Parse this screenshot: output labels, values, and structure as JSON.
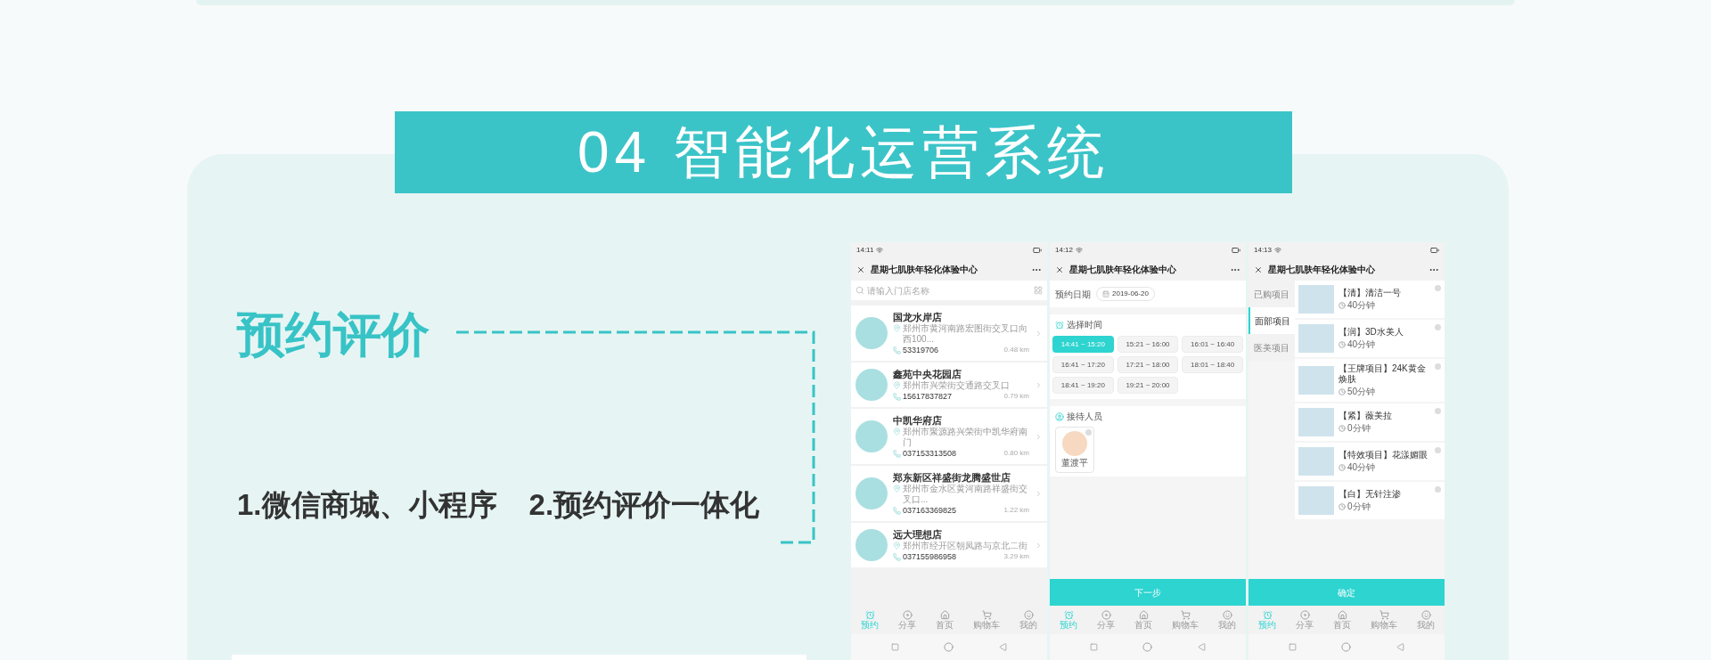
{
  "banner": {
    "title": "04 智能化运营系统"
  },
  "feature": {
    "title": "预约评价",
    "points": [
      "1.微信商城、小程序",
      "2.预约评价一体化"
    ]
  },
  "phones": [
    {
      "kind": "store_list",
      "time": "14:11",
      "app_title": "星期七肌肤年轻化体验中心",
      "search": {
        "placeholder": "请输入门店名称"
      },
      "stores": [
        {
          "name": "国龙水岸店",
          "address": "郑州市黄河南路宏图街交叉口向西100...",
          "phone": "53319706",
          "distance": "0.48 km"
        },
        {
          "name": "鑫苑中央花园店",
          "address": "郑州市兴荣街交通路交叉口",
          "phone": "15617837827",
          "distance": "0.79 km"
        },
        {
          "name": "中凯华府店",
          "address": "郑州市聚源路兴荣街中凯华府南门",
          "phone": "037153313508",
          "distance": "0.80 km"
        },
        {
          "name": "郑东新区祥盛街龙腾盛世店",
          "address": "郑州市金水区黄河南路祥盛街交叉口...",
          "phone": "037163369825",
          "distance": "1.22 km"
        },
        {
          "name": "远大理想店",
          "address": "郑州市经开区朝凤路与京北二街",
          "phone": "037155986958",
          "distance": "3.29 km"
        }
      ],
      "tabs": [
        {
          "label": "预约",
          "selected": true
        },
        {
          "label": "分享",
          "selected": false
        },
        {
          "label": "首页",
          "selected": false
        },
        {
          "label": "购物车",
          "selected": false
        },
        {
          "label": "我的",
          "selected": false
        }
      ]
    },
    {
      "kind": "booking",
      "time": "14:12",
      "app_title": "星期七肌肤年轻化体验中心",
      "date_label": "预约日期",
      "date": "2019-06-20",
      "time_section": "选择时间",
      "slots": [
        {
          "label": "14:41 ~ 15:20",
          "selected": true
        },
        {
          "label": "15:21 ~ 16:00",
          "selected": false
        },
        {
          "label": "16:01 ~ 16:40",
          "selected": false
        },
        {
          "label": "16:41 ~ 17:20",
          "selected": false
        },
        {
          "label": "17:21 ~ 18:00",
          "selected": false
        },
        {
          "label": "18:01 ~ 18:40",
          "selected": false
        },
        {
          "label": "18:41 ~ 19:20",
          "selected": false
        },
        {
          "label": "19:21 ~ 20:00",
          "selected": false
        }
      ],
      "staff_section": "接待人员",
      "staff": [
        {
          "name": "董渡平",
          "selected": false
        }
      ],
      "button": "下一步",
      "tabs": [
        {
          "label": "预约",
          "selected": true
        },
        {
          "label": "分享",
          "selected": false
        },
        {
          "label": "首页",
          "selected": false
        },
        {
          "label": "购物车",
          "selected": false
        },
        {
          "label": "我的",
          "selected": false
        }
      ]
    },
    {
      "kind": "services",
      "time": "14:13",
      "app_title": "星期七肌肤年轻化体验中心",
      "categories": [
        {
          "label": "已购项目",
          "selected": false
        },
        {
          "label": "面部项目",
          "selected": true
        },
        {
          "label": "医美项目",
          "selected": false
        }
      ],
      "services": [
        {
          "name": "【清】清洁一号",
          "duration": "40分钟",
          "checked": false
        },
        {
          "name": "【润】3D水美人",
          "duration": "40分钟",
          "checked": false
        },
        {
          "name": "【王牌项目】24K黄金焕肤",
          "duration": "50分钟",
          "checked": false
        },
        {
          "name": "【紧】薇美拉",
          "duration": "0分钟",
          "checked": false
        },
        {
          "name": "【特效项目】花漾媚眼",
          "duration": "40分钟",
          "checked": false
        },
        {
          "name": "【白】无针注渗",
          "duration": "0分钟",
          "checked": false
        }
      ],
      "button": "确定",
      "tabs": [
        {
          "label": "预约",
          "selected": true
        },
        {
          "label": "分享",
          "selected": false
        },
        {
          "label": "首页",
          "selected": false
        },
        {
          "label": "购物车",
          "selected": false
        },
        {
          "label": "我的",
          "selected": false
        }
      ]
    }
  ]
}
